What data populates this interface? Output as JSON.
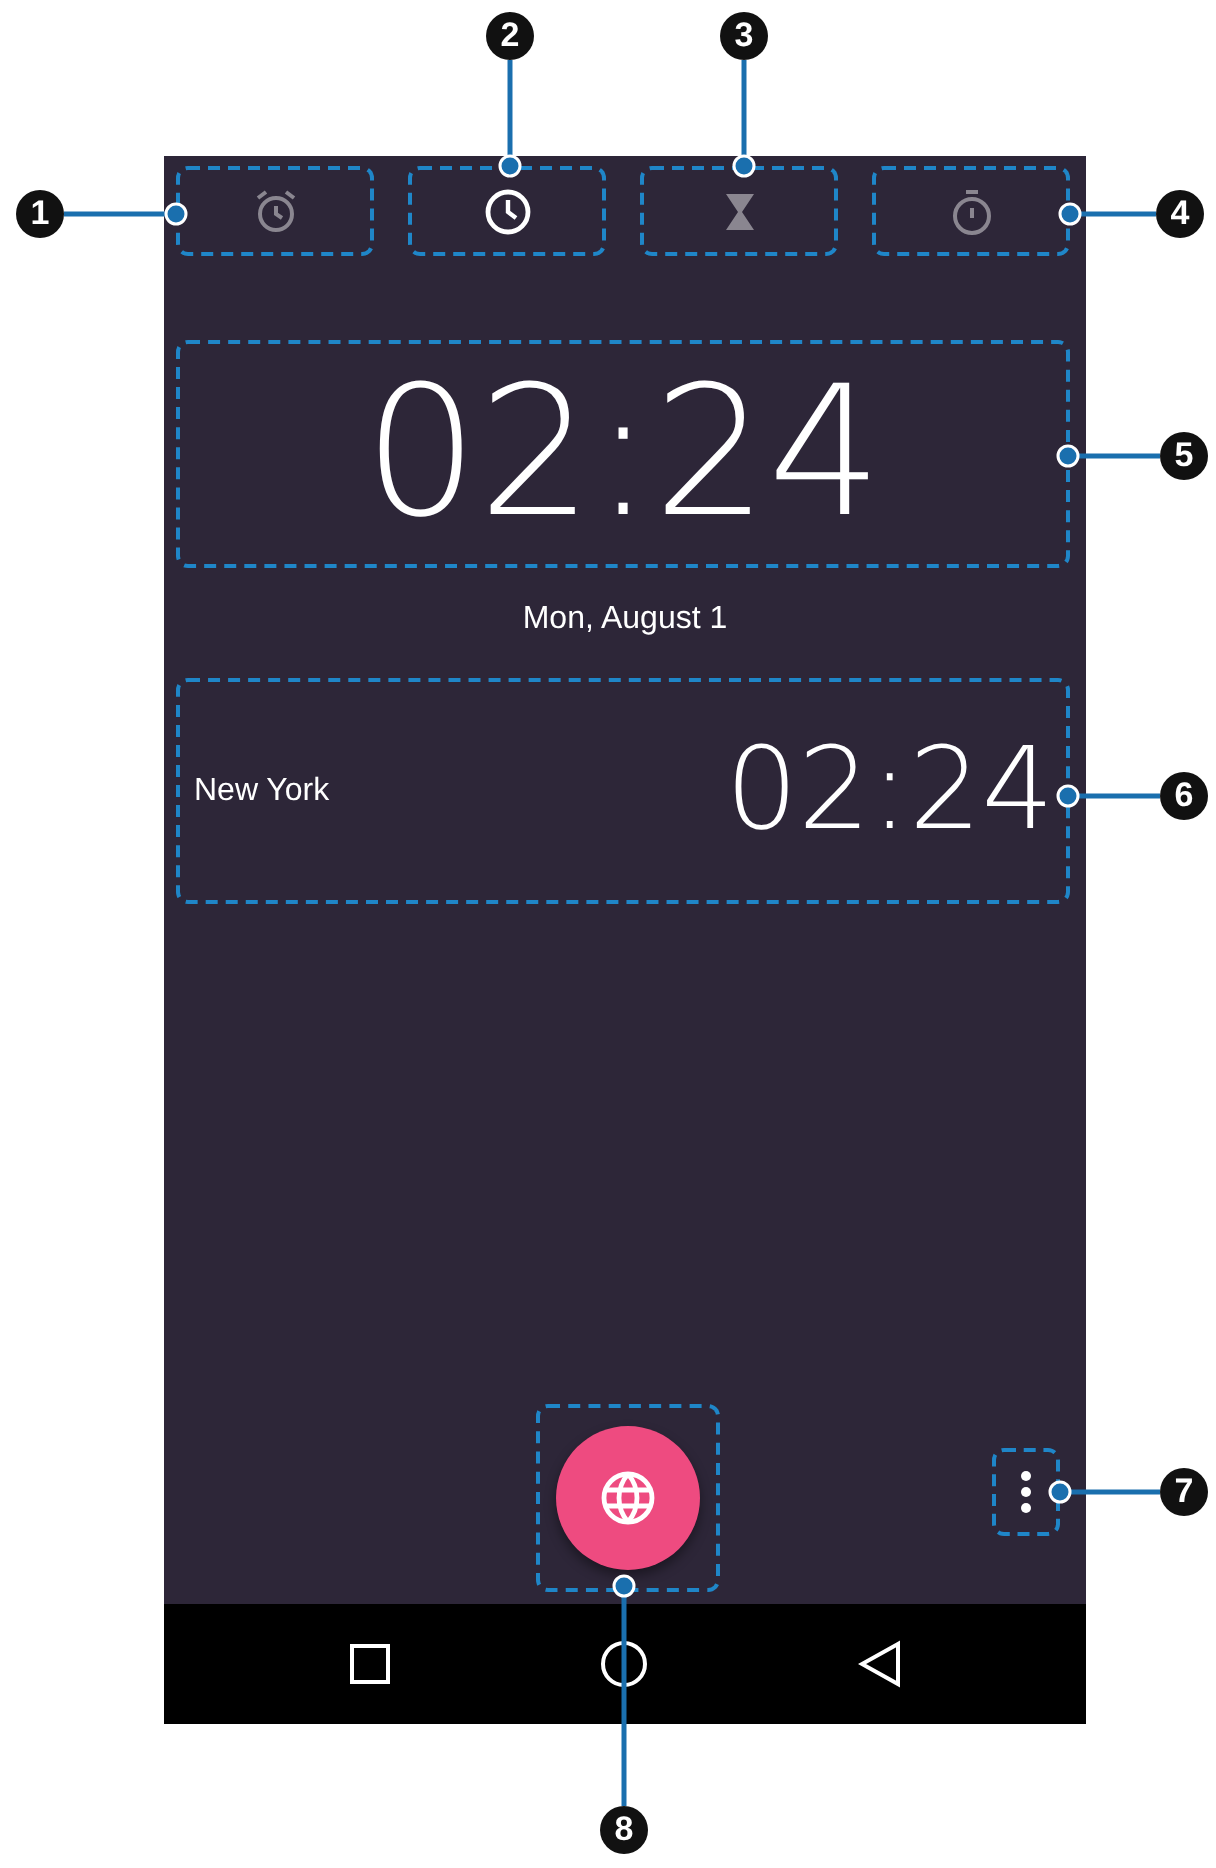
{
  "tabs": [
    {
      "kind": "alarm",
      "selected": false
    },
    {
      "kind": "clock",
      "selected": true
    },
    {
      "kind": "timer",
      "selected": false
    },
    {
      "kind": "stopwatch",
      "selected": false
    }
  ],
  "clock": {
    "time": "02:24",
    "date": "Mon, August 1"
  },
  "cities": [
    {
      "name": "New York",
      "time": "02:24"
    }
  ],
  "callouts": [
    {
      "number": "1"
    },
    {
      "number": "2"
    },
    {
      "number": "3"
    },
    {
      "number": "4"
    },
    {
      "number": "5"
    },
    {
      "number": "6"
    },
    {
      "number": "7"
    },
    {
      "number": "8"
    }
  ]
}
